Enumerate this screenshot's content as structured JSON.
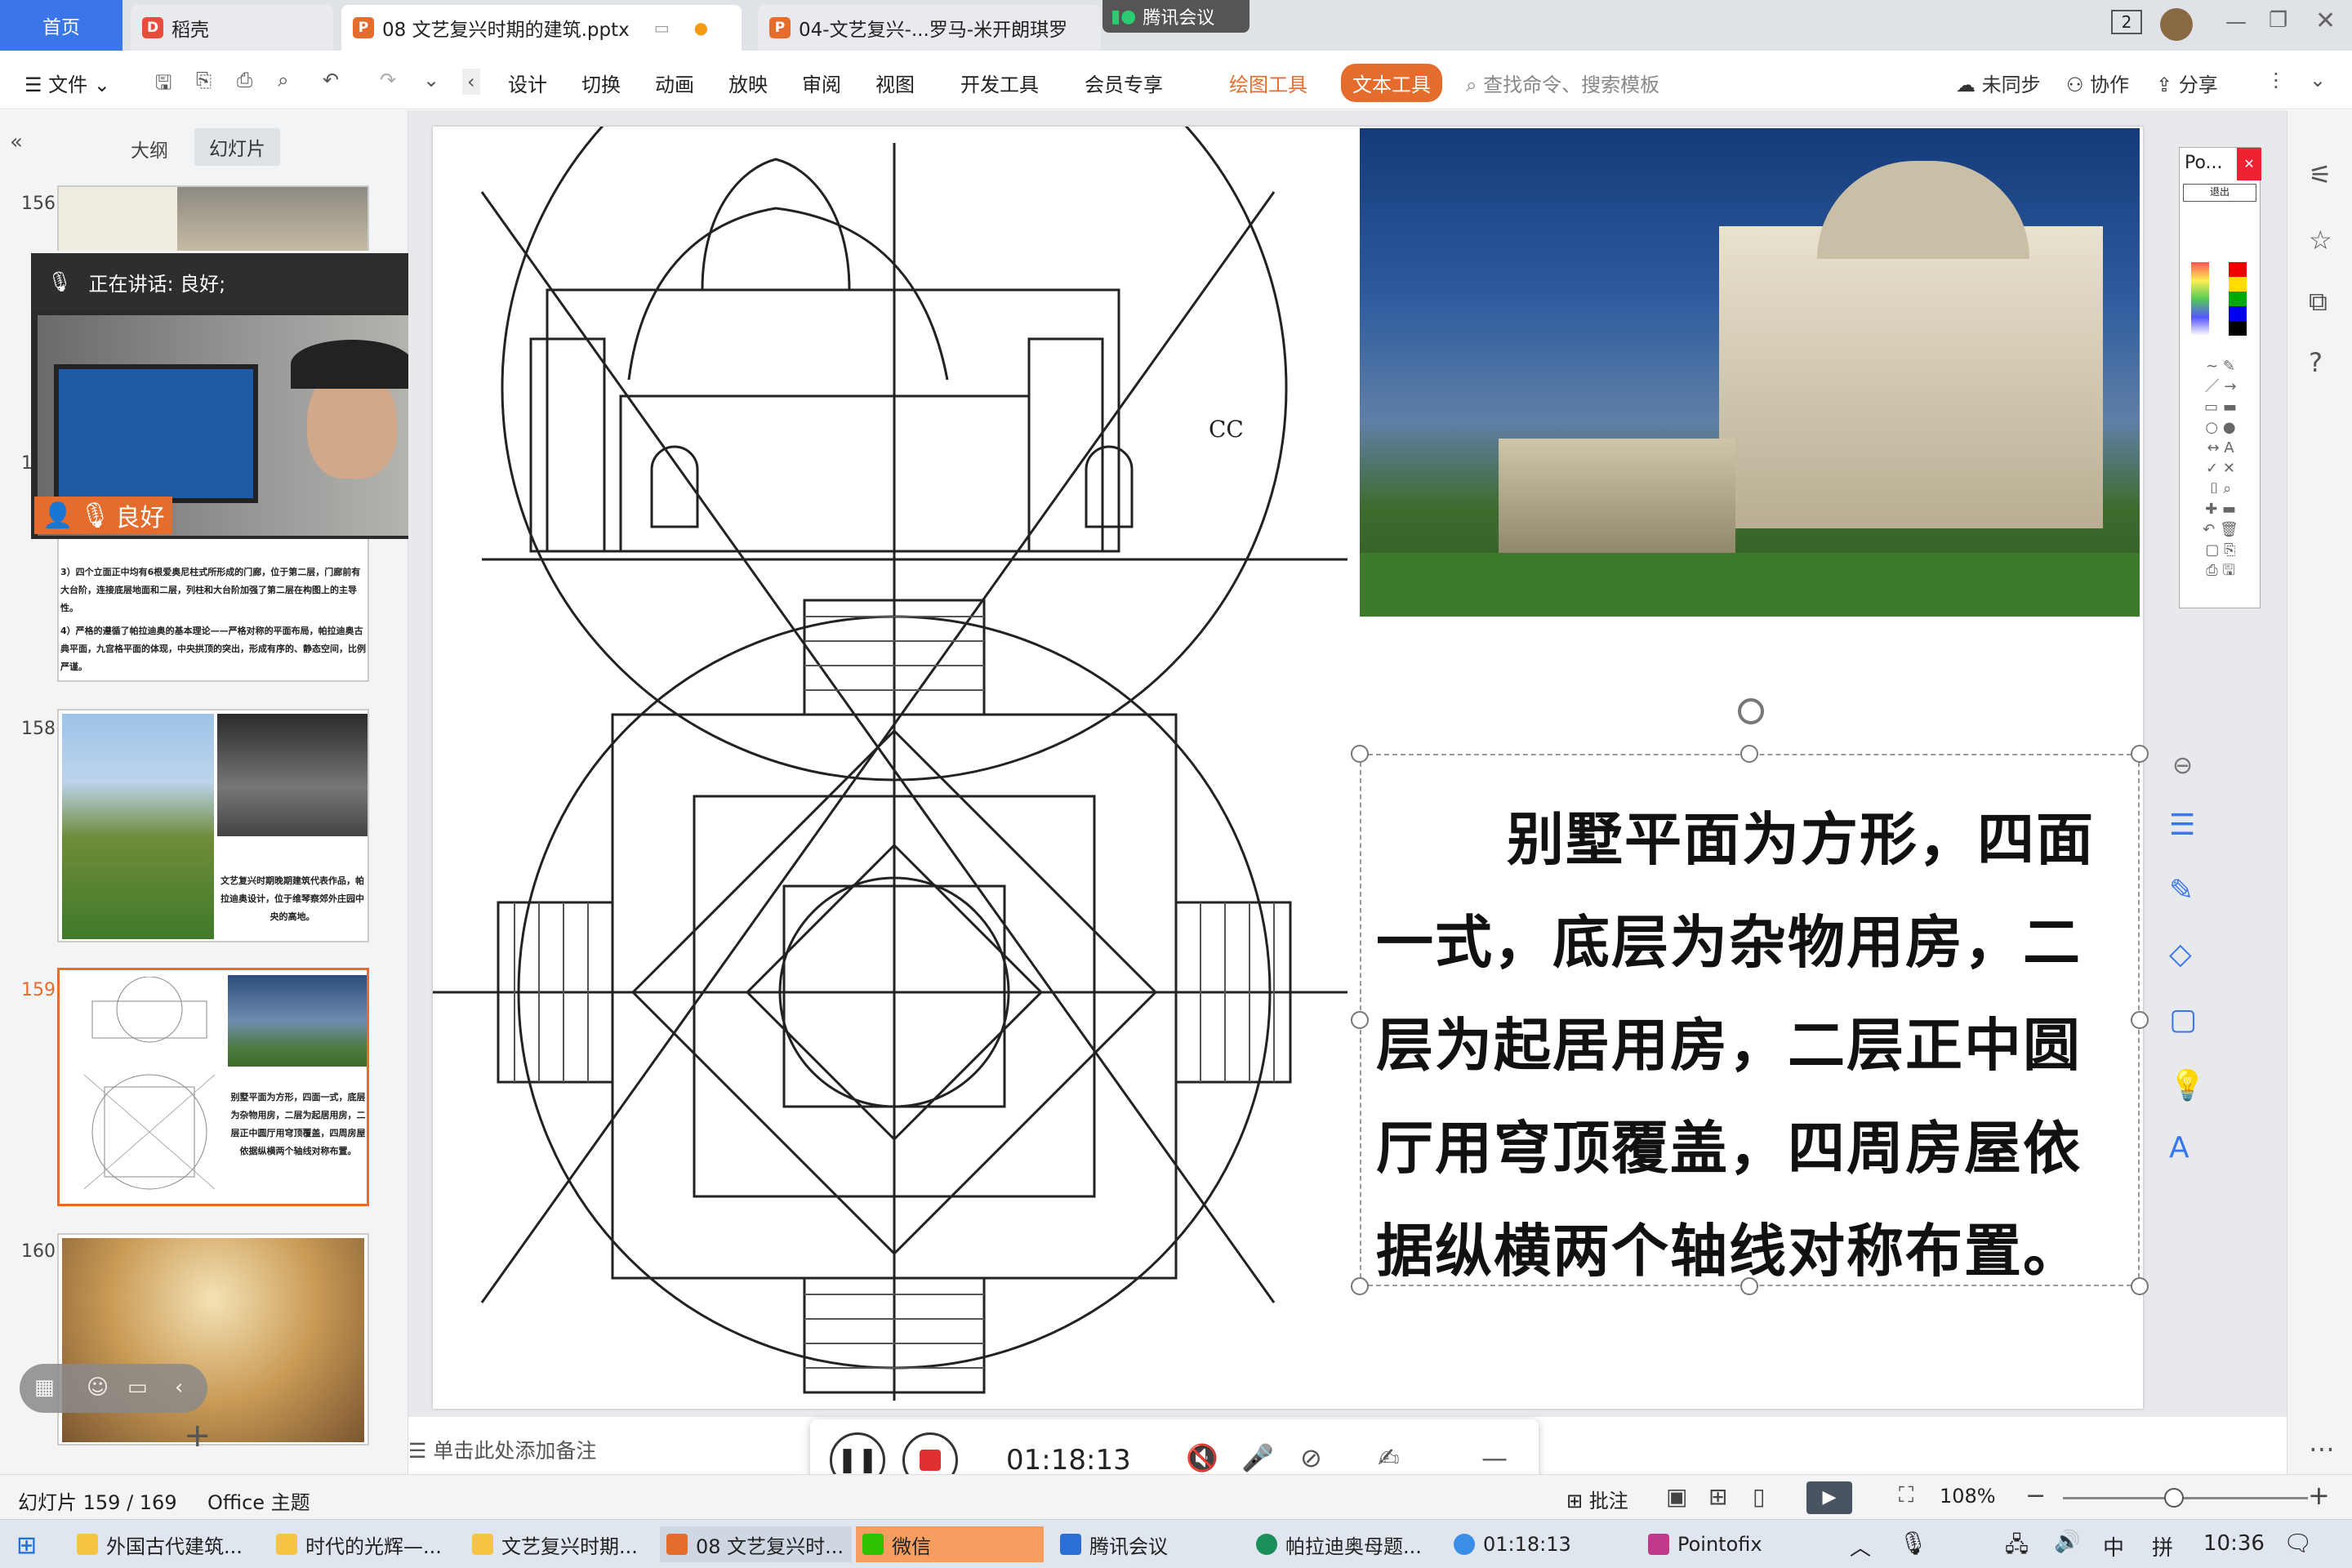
{
  "tabs": {
    "home": "首页",
    "daoke": "稻壳",
    "doc1": "08 文艺复兴时期的建筑.pptx",
    "doc2": "04-文艺复兴-...罗马-米开朗琪罗",
    "meeting_pill": "腾讯会议",
    "count_badge": "2"
  },
  "menu": {
    "file": "文件",
    "items": [
      "设计",
      "切换",
      "动画",
      "放映",
      "审阅",
      "视图",
      "开发工具",
      "会员专享"
    ],
    "drawing_tools": "绘图工具",
    "text_tools": "文本工具",
    "search": "查找命令、搜索模板",
    "sync": "未同步",
    "collab": "协作",
    "share": "分享"
  },
  "leftpanel": {
    "outline": "大纲",
    "slides": "幻灯片",
    "numbers": [
      "156",
      "1",
      "158",
      "159",
      "160"
    ],
    "thumb157_lines": [
      "3）四个立面正中均有6根爱奥尼柱式所形成的门廊，位于第二层，门廊前有大台阶，连接底层地面和二层，列柱和大台阶加强了第二层在构图上的主导性。",
      "4）严格的遵循了帕拉迪奥的基本理论——严格对称的平面布局，帕拉迪奥古典平面，九宫格平面的体现，中央拱顶的突出，形成有序的、静态空间，比例严谨。"
    ],
    "thumb158_caption": "文艺复兴时期晚期建筑代表作品，帕拉迪奥设计，位于维琴察郊外庄园中央的高地。",
    "thumb159_caption": "别墅平面为方形，四面一式，底层为杂物用房，二层为起居用房，二层正中圆厅用穹顶覆盖，四周房屋依据纵横两个轴线对称布置。"
  },
  "meeting": {
    "speaking": "正在讲话: 良好;",
    "name": "良好"
  },
  "slide": {
    "body": "别墅平面为方形，四面一式，底层为杂物用房，二层为起居用房，二层正中圆厅用穹顶覆盖，四周房屋依据纵横两个轴线对称布置。",
    "cc": "CC"
  },
  "notes": "单击此处添加备注",
  "recording": {
    "time": "01:18:13"
  },
  "status": {
    "slide_count": "幻灯片 159 / 169",
    "theme": "Office 主题",
    "comment": "批注",
    "zoom": "108%"
  },
  "pointofix": {
    "title": "Po...",
    "exit": "退出"
  },
  "taskbar": {
    "items": [
      "外国古代建筑...",
      "时代的光辉—...",
      "文艺复兴时期...",
      "08 文艺复兴时...",
      "微信",
      "腾讯会议",
      "帕拉迪奥母题...",
      "01:18:13",
      "Pointofix"
    ],
    "ime1": "中",
    "ime2": "拼",
    "clock": "10:36"
  },
  "colors": {
    "accent": "#c0392b",
    "tab_active": "#ffffff",
    "wechat": "#f59e60",
    "orange": "#e46c2d"
  }
}
